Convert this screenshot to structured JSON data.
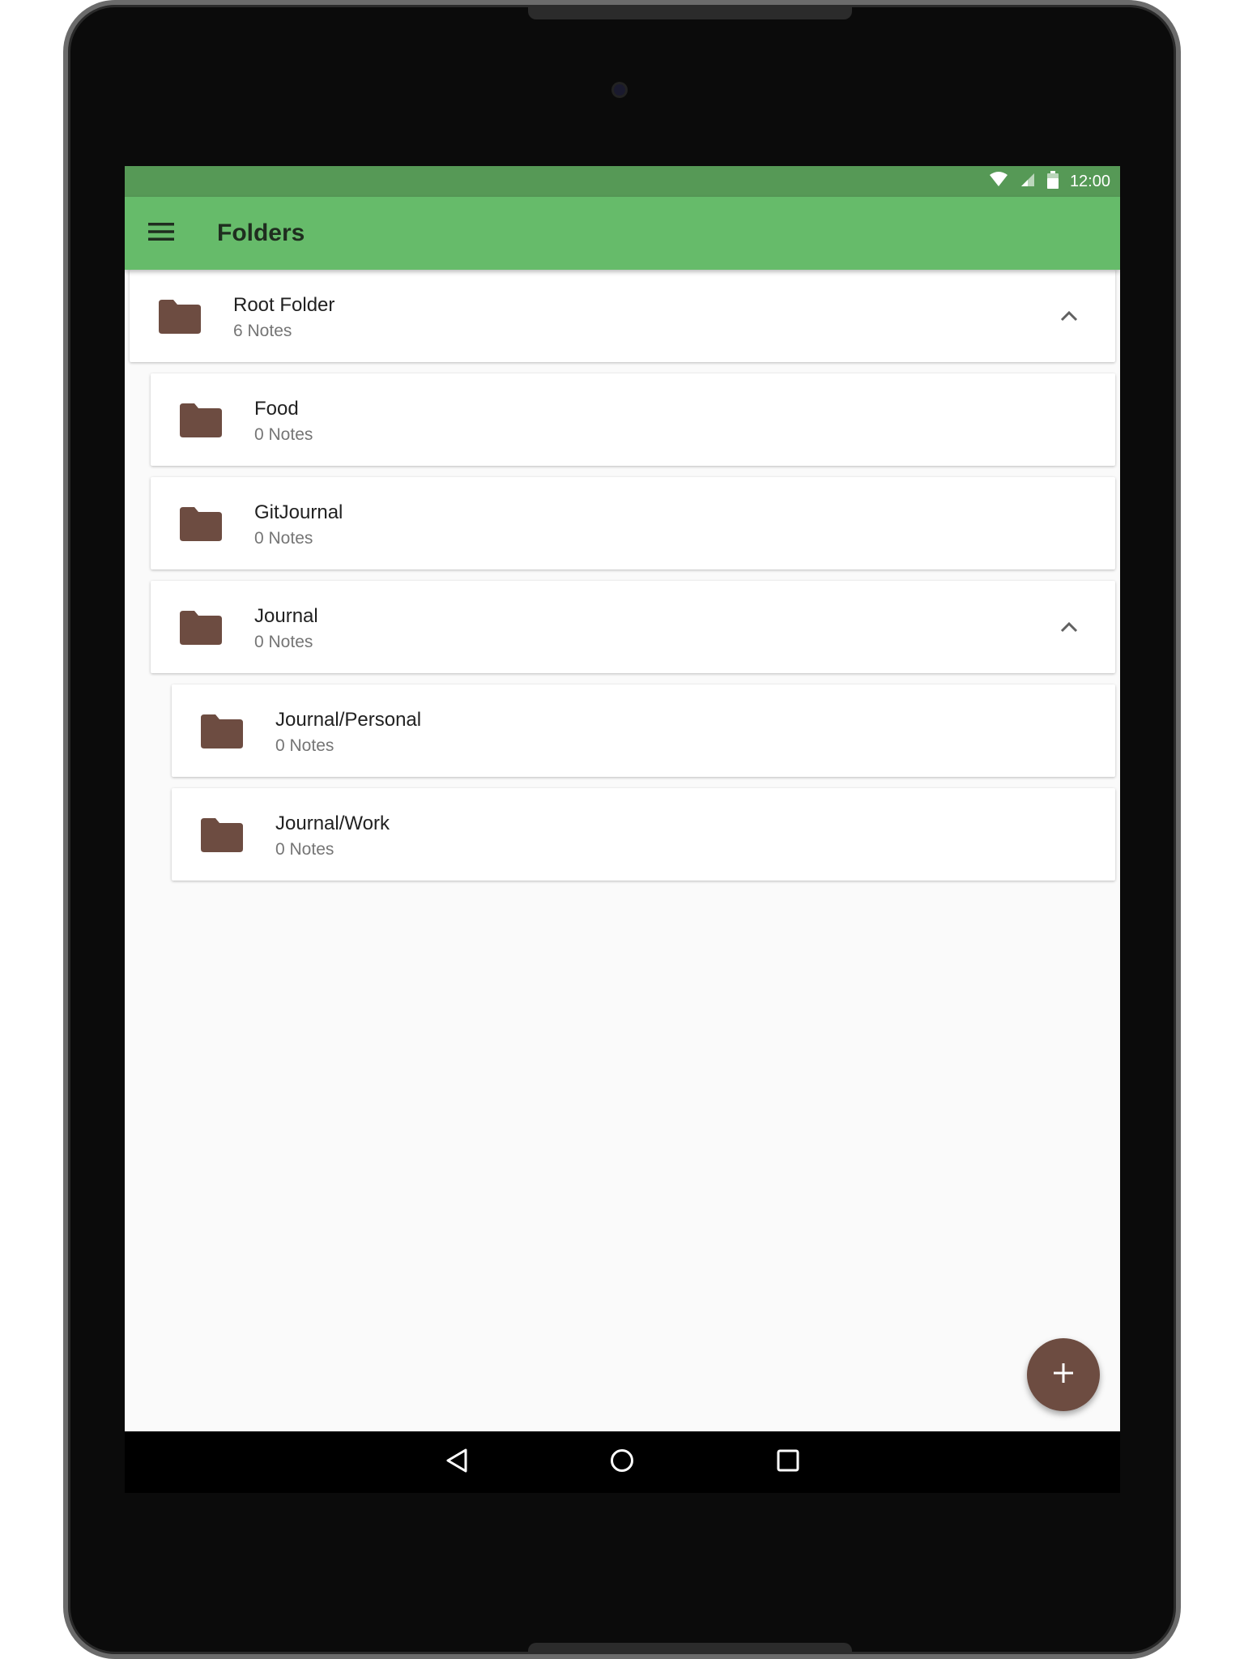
{
  "status_bar": {
    "time": "12:00",
    "icons": [
      "wifi-icon",
      "signal-icon",
      "battery-icon"
    ]
  },
  "app_bar": {
    "title": "Folders",
    "menu_icon": "menu-icon"
  },
  "folders": [
    {
      "name": "Root Folder",
      "count": "6 Notes",
      "expanded": true
    },
    {
      "name": "Food",
      "count": "0 Notes"
    },
    {
      "name": "GitJournal",
      "count": "0 Notes"
    },
    {
      "name": "Journal",
      "count": "0 Notes",
      "expanded": true
    },
    {
      "name": "Journal/Personal",
      "count": "0 Notes"
    },
    {
      "name": "Journal/Work",
      "count": "0 Notes"
    }
  ],
  "fab": {
    "icon": "plus-icon"
  },
  "nav_bar": {
    "icons": [
      "back-icon",
      "home-icon",
      "recents-icon"
    ]
  },
  "colors": {
    "status_bar": "#569956",
    "app_bar": "#66bb6a",
    "folder_icon": "#6d4c41",
    "fab": "#6d4c41",
    "background": "#fafafa"
  }
}
